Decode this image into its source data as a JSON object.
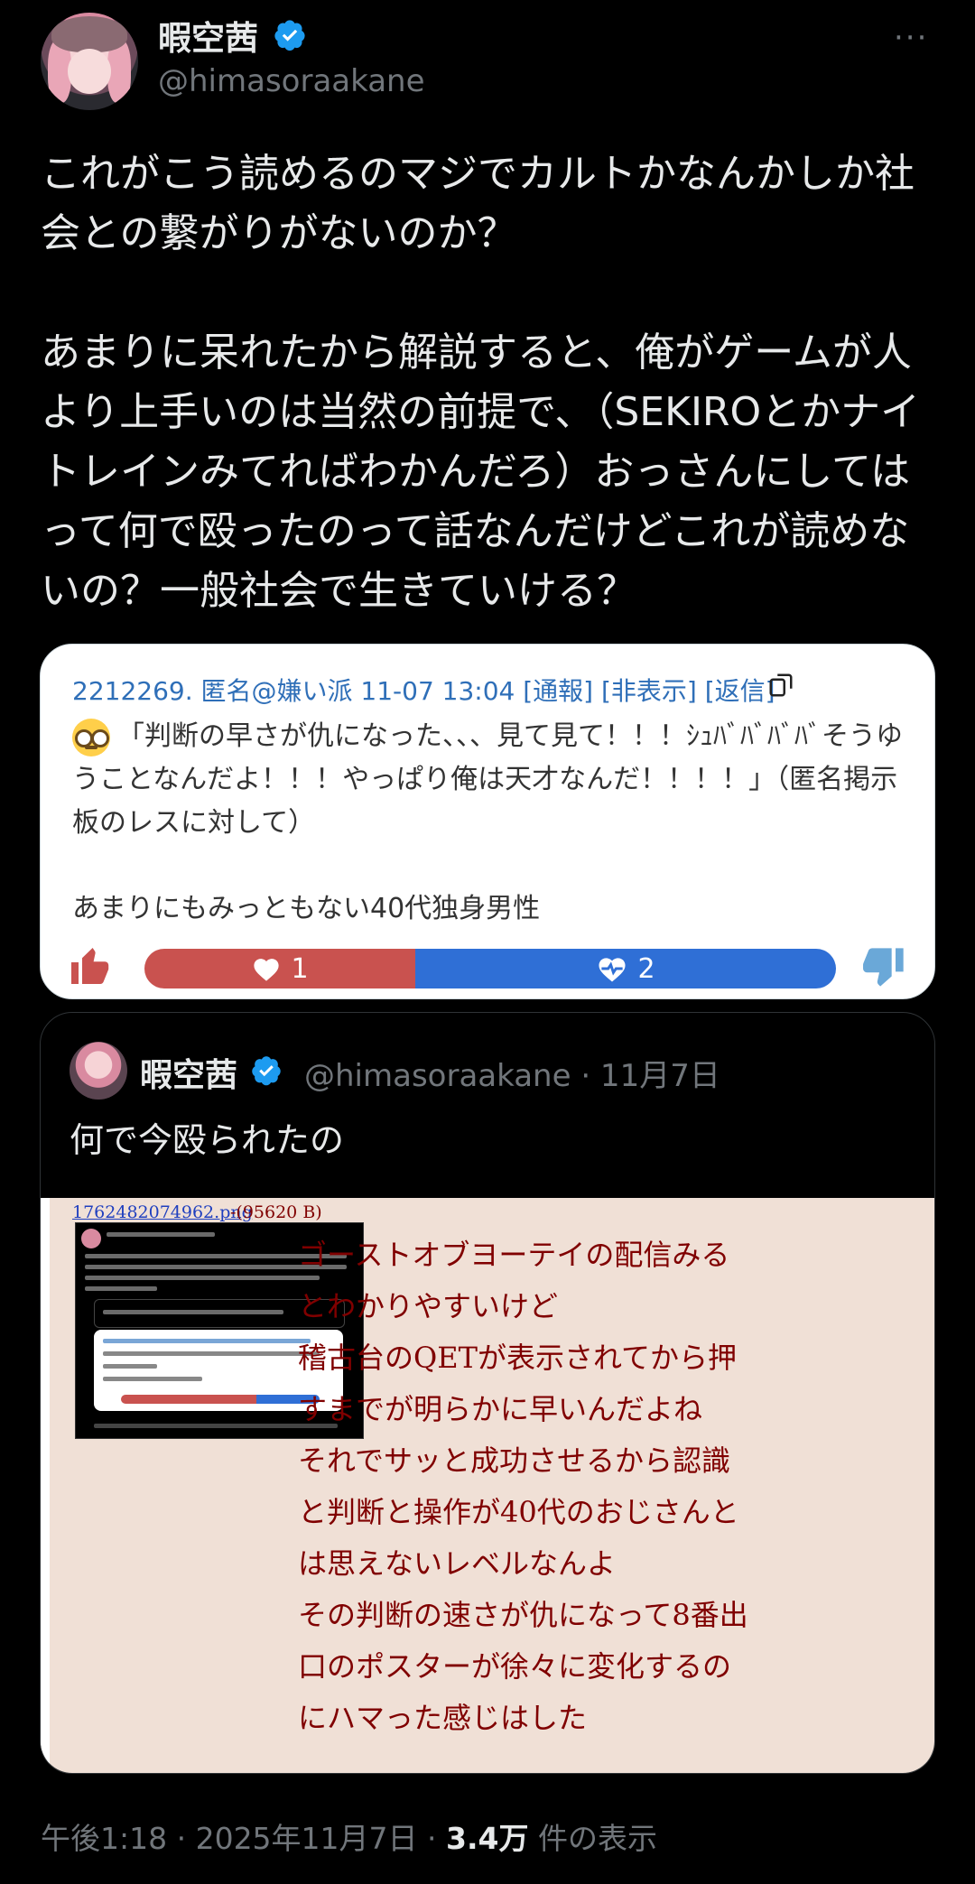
{
  "author": {
    "display_name": "暇空茜",
    "handle": "@himasoraakane",
    "avatar_icon": "avatar",
    "verified_icon": "verified-badge-icon"
  },
  "menu_icon": "more-options-icon",
  "menu_label": "···",
  "tweet_text": "これがこう読めるのマジでカルトかなんかしか社会との繋がりがないのか？\n\nあまりに呆れたから解説すると、俺がゲームが人より上手いのは当然の前提で、（SEKIROとかナイトレインみてればわかんだろ）おっさんにしてはって何で殴ったのって話なんだけどこれが読めないの？一般社会で生きていける？",
  "embed_card": {
    "header": "2212269. 匿名@嫌い派 11-07 13:04  [通報]  [非表示]  [返信]",
    "body": "「判断の早さが仇になった、、、見て見て！！！ｼｭﾊﾞﾊﾞﾊﾞﾊﾞそうゆうことなんだよ！！！やっぱり俺は天才なんだ！！！！」（匿名掲示板のレスに対して）",
    "note": "あまりにもみっともない40代独身男性",
    "likes": "1",
    "dislikes": "2",
    "like_color": "#c9524f",
    "dislike_color": "#2f6fd6"
  },
  "quote": {
    "display_name": "暇空茜",
    "handle_date": "@himasoraakane · 11月7日",
    "text": "何で今殴られたの",
    "file_name": "1762482074962.png",
    "file_size": "-(95620 B)",
    "image_text": "ゴーストオブヨーテイの配信みる\nとわかりやすいけど\n稽古台のQETが表示されてから押\nすまでが明らかに早いんだよね\nそれでサッと成功させるから認識\nと判断と操作が40代のおじさんと\nは思えないレベルなんよ\nその判断の速さが仇になって8番出\n口のポスターが徐々に変化するの\nにハマった感じはした"
  },
  "footer": {
    "time": "午後1:18 · 2025年11月7日 · ",
    "views": "3.4万",
    "views_label": " 件の表示"
  },
  "colors": {
    "background": "#000000",
    "text": "#e7e9ea",
    "muted": "#71767b",
    "verified": "#1d9bf0",
    "link": "#2f6fb8",
    "futaba_bg": "#f0e0d6",
    "futaba_text": "#800000"
  }
}
